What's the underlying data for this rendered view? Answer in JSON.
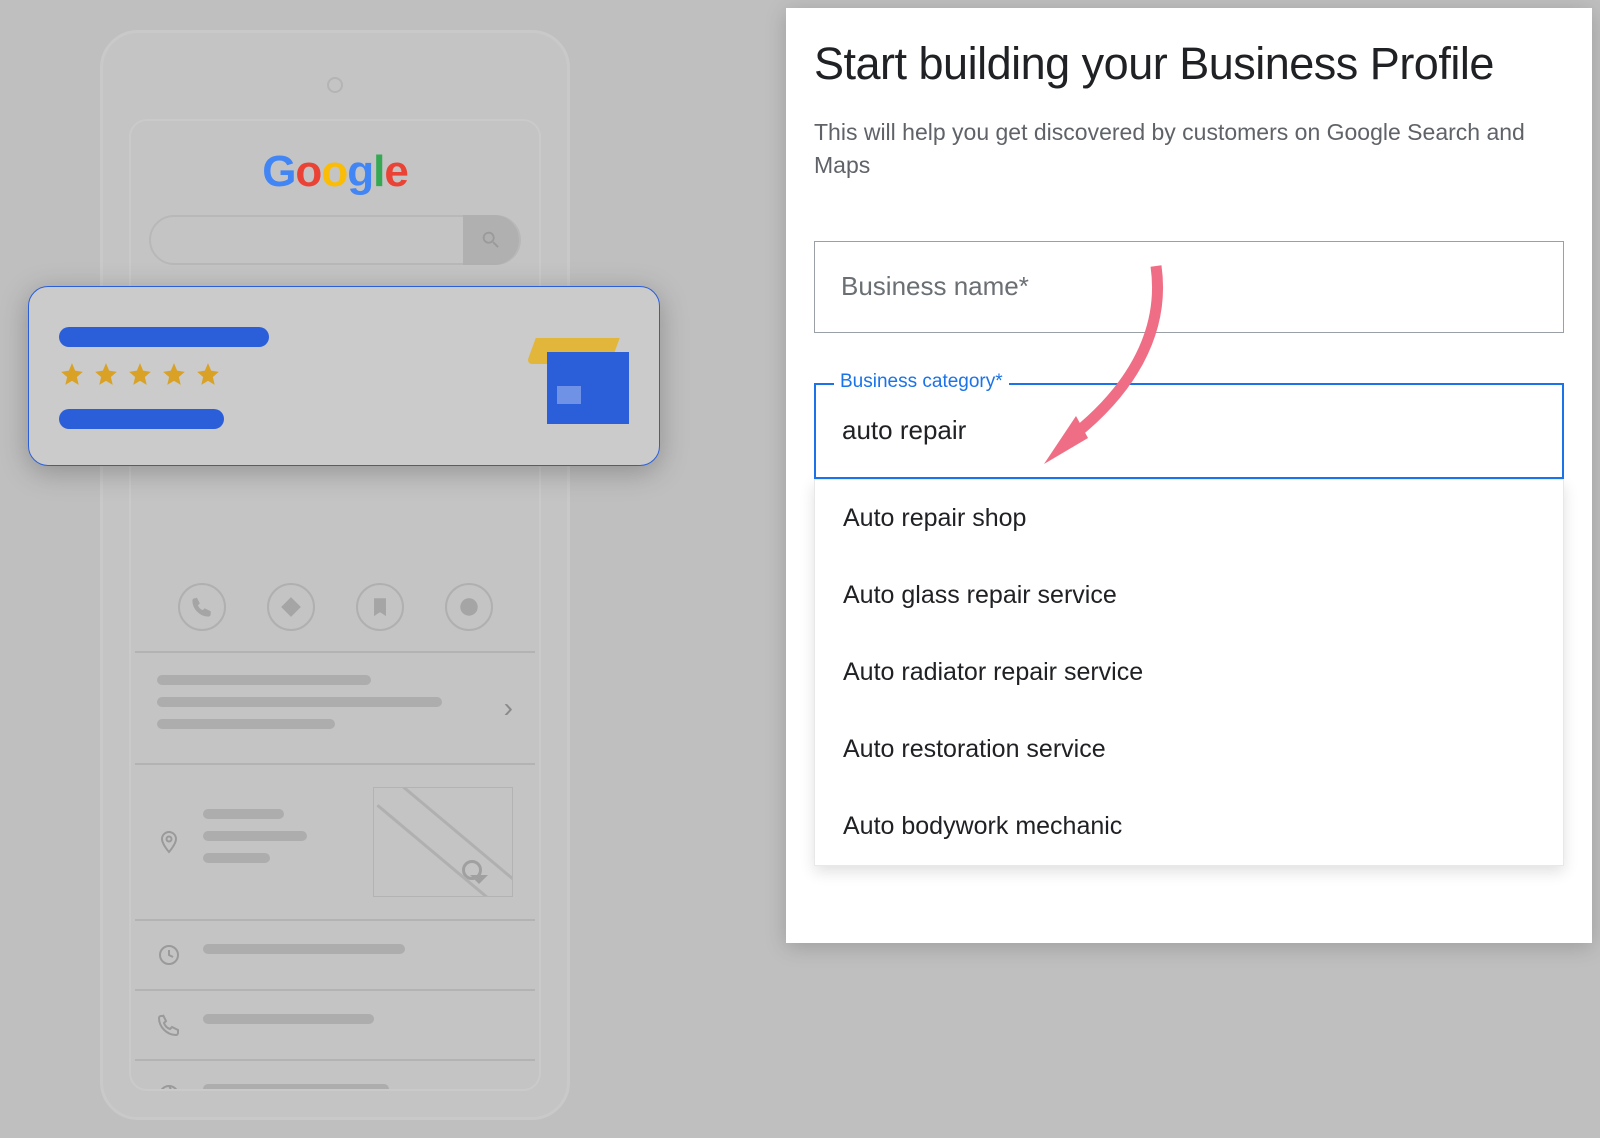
{
  "logo": {
    "g": "G",
    "o1": "o",
    "o2": "o",
    "g2": "g",
    "l": "l",
    "e": "e"
  },
  "panel": {
    "heading": "Start building your Business Profile",
    "description": "This will help you get discovered by customers on Google Search and Maps",
    "businessNamePlaceholder": "Business name*",
    "categoryLabel": "Business category*",
    "categoryValue": "auto repair",
    "options": [
      "Auto repair shop",
      "Auto glass repair service",
      "Auto radiator repair service",
      "Auto restoration service",
      "Auto bodywork mechanic"
    ]
  }
}
